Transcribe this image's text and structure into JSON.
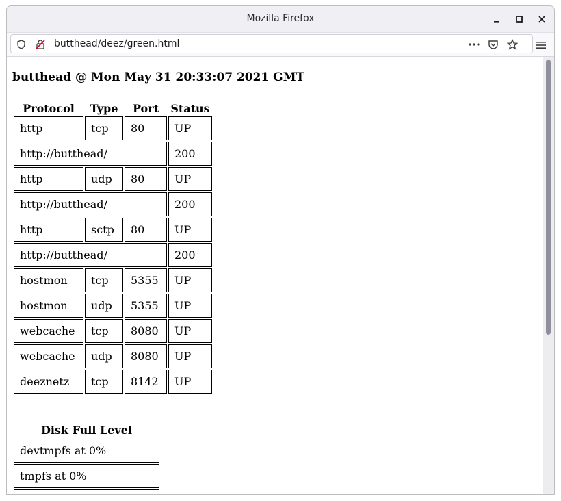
{
  "window": {
    "title": "Mozilla Firefox"
  },
  "urlbar": {
    "url": "butthead/deez/green.html"
  },
  "page": {
    "heading": "butthead @ Mon May 31 20:33:07 2021 GMT",
    "services": {
      "headers": [
        "Protocol",
        "Type",
        "Port",
        "Status"
      ],
      "rows": [
        {
          "protocol": "http",
          "type": "tcp",
          "port": "80",
          "status": "UP"
        },
        {
          "url": "http://butthead/",
          "code": "200"
        },
        {
          "protocol": "http",
          "type": "udp",
          "port": "80",
          "status": "UP"
        },
        {
          "url": "http://butthead/",
          "code": "200"
        },
        {
          "protocol": "http",
          "type": "sctp",
          "port": "80",
          "status": "UP"
        },
        {
          "url": "http://butthead/",
          "code": "200"
        },
        {
          "protocol": "hostmon",
          "type": "tcp",
          "port": "5355",
          "status": "UP"
        },
        {
          "protocol": "hostmon",
          "type": "udp",
          "port": "5355",
          "status": "UP"
        },
        {
          "protocol": "webcache",
          "type": "tcp",
          "port": "8080",
          "status": "UP"
        },
        {
          "protocol": "webcache",
          "type": "udp",
          "port": "8080",
          "status": "UP"
        },
        {
          "protocol": "deeznetz",
          "type": "tcp",
          "port": "8142",
          "status": "UP"
        }
      ]
    },
    "disk": {
      "title": "Disk Full Level",
      "rows": [
        "devtmpfs at 0%",
        "tmpfs at 0%",
        ""
      ]
    }
  }
}
